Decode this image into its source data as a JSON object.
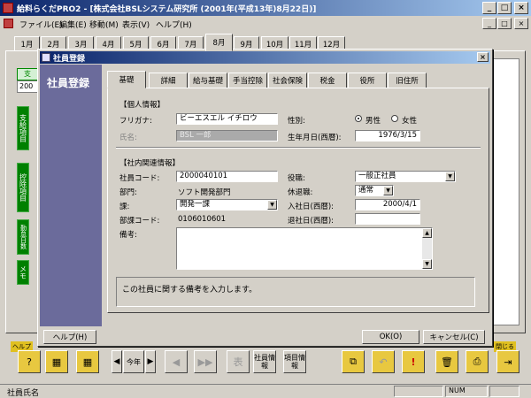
{
  "app": {
    "title": "給料らくだPRO2 - [株式会社BSLシステム研究所 (2001年(平成13年)8月22日)]",
    "menu": [
      "ファイル(E)",
      "編集(E)",
      "移動(M)",
      "表示(V)",
      "ヘルプ(H)"
    ]
  },
  "months": [
    "1月",
    "2月",
    "3月",
    "4月",
    "5月",
    "6月",
    "7月",
    "8月",
    "9月",
    "10月",
    "11月",
    "12月"
  ],
  "active_month": "8月",
  "side": {
    "header": "支",
    "value": "200",
    "buttons": [
      "支給項目",
      "控除項目",
      "勤怠日数",
      "メモ"
    ]
  },
  "dialog": {
    "title": "社員登録",
    "heading": "社員登録",
    "tabs": [
      "基礎",
      "詳細",
      "給与基礎",
      "手当控除",
      "社会保険",
      "税金",
      "役所",
      "旧住所"
    ],
    "active_tab": "基礎",
    "personal": {
      "section": "【個人情報】",
      "furigana_label": "フリガナ:",
      "furigana_value": "ビーエスエル イチロウ",
      "name_label": "氏名:",
      "name_value": "BSL 一郎",
      "gender_label": "性別:",
      "gender_male": "男性",
      "gender_female": "女性",
      "birth_label": "生年月日(西暦):",
      "birth_value": "1976/3/15"
    },
    "company": {
      "section": "【社内関連情報】",
      "code_label": "社員コード:",
      "code_value": "2000040101",
      "dept_label": "部門:",
      "dept_value": "ソフト開発部門",
      "section_label": "課:",
      "section_value": "開発一課",
      "deptcode_label": "部課コード:",
      "deptcode_value": "0106010601",
      "post_label": "役職:",
      "post_value": "一般正社員",
      "leave_label": "休退職:",
      "leave_value": "通常",
      "join_label": "入社日(西暦):",
      "join_value": "2000/4/1",
      "exit_label": "退社日(西暦):",
      "exit_value": "",
      "memo_label": "備考:",
      "memo_value": ""
    },
    "hint": "この社員に関する備考を入力します。",
    "help_button": "ヘルプ(H)",
    "ok_button": "OK(O)",
    "cancel_button": "キャンセル(C)"
  },
  "toolbar": {
    "help_label": "ヘルプ",
    "close_label": "閉じる",
    "year_label": "今年",
    "employee_info": "社員情報",
    "item_info": "項目情報",
    "table_label": "表"
  },
  "status": {
    "left": "社員氏名",
    "num": "NUM"
  },
  "colors": {
    "title_start": "#0a246a",
    "title_end": "#a6caf0",
    "side_green": "#008000",
    "dialog_left": "#6b6b9b"
  }
}
